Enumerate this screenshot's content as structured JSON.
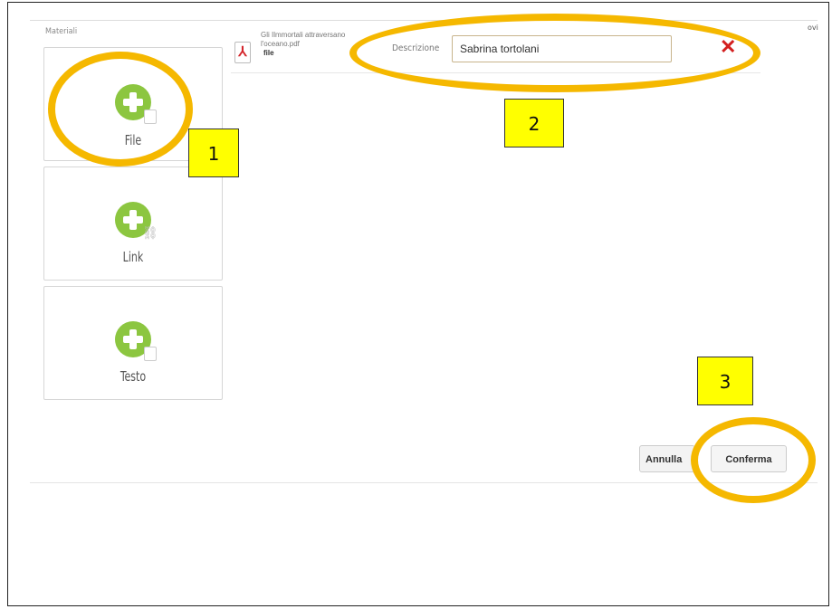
{
  "corner_text": "ovi",
  "section_label": "Materiali",
  "tiles": [
    {
      "label": "File",
      "icon": "add-file-icon"
    },
    {
      "label": "Link",
      "icon": "add-link-icon"
    },
    {
      "label": "Testo",
      "icon": "add-text-icon"
    }
  ],
  "file_item": {
    "name": "Gli Ilmmortali attraversano l'oceano.pdf",
    "type": "file",
    "icon": "pdf-icon",
    "description_label": "Descrizione",
    "description_value": "Sabrina tortolani"
  },
  "buttons": {
    "cancel_label": "Annulla",
    "confirm_label": "Conferma"
  },
  "callouts": [
    "1",
    "2",
    "3"
  ],
  "colors": {
    "accent_green": "#8cc640",
    "highlight_ring": "#f5b800",
    "callout_yellow": "#ffff00",
    "delete_red": "#d31f1f"
  }
}
